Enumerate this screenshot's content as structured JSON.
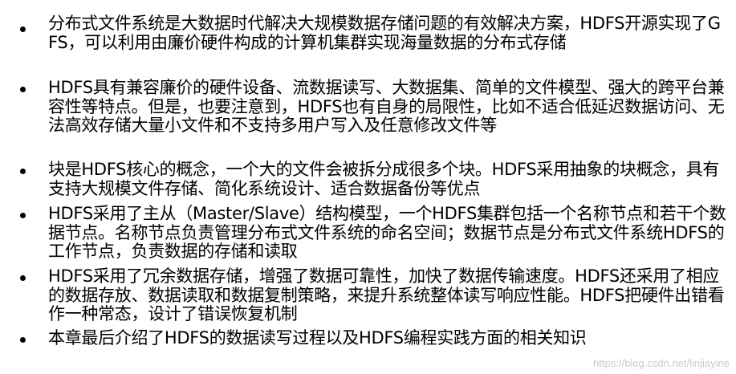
{
  "bullets": [
    {
      "text": "分布式文件系统是大数据时代解决大规模数据存储问题的有效解决方案，HDFS开源实现了GFS，可以利用由廉价硬件构成的计算机集群实现海量数据的分布式存储"
    },
    {
      "text": "HDFS具有兼容廉价的硬件设备、流数据读写、大数据集、简单的文件模型、强大的跨平台兼容性等特点。但是，也要注意到，HDFS也有自身的局限性，比如不适合低延迟数据访问、无法高效存储大量小文件和不支持多用户写入及任意修改文件等"
    },
    {
      "text": "块是HDFS核心的概念，一个大的文件会被拆分成很多个块。HDFS采用抽象的块概念，具有支持大规模文件存储、简化系统设计、适合数据备份等优点"
    },
    {
      "text": "HDFS采用了主从（Master/Slave）结构模型，一个HDFS集群包括一个名称节点和若干个数据节点。名称节点负责管理分布式文件系统的命名空间；数据节点是分布式文件系统HDFS的工作节点，负责数据的存储和读取"
    },
    {
      "text": "HDFS采用了冗余数据存储，增强了数据可靠性，加快了数据传输速度。HDFS还采用了相应的数据存放、数据读取和数据复制策略，来提升系统整体读写响应性能。HDFS把硬件出错看作一种常态，设计了错误恢复机制"
    },
    {
      "text": "本章最后介绍了HDFS的数据读写过程以及HDFS编程实践方面的相关知识"
    }
  ],
  "watermark": "https://blog.csdn.net/linjiayine"
}
